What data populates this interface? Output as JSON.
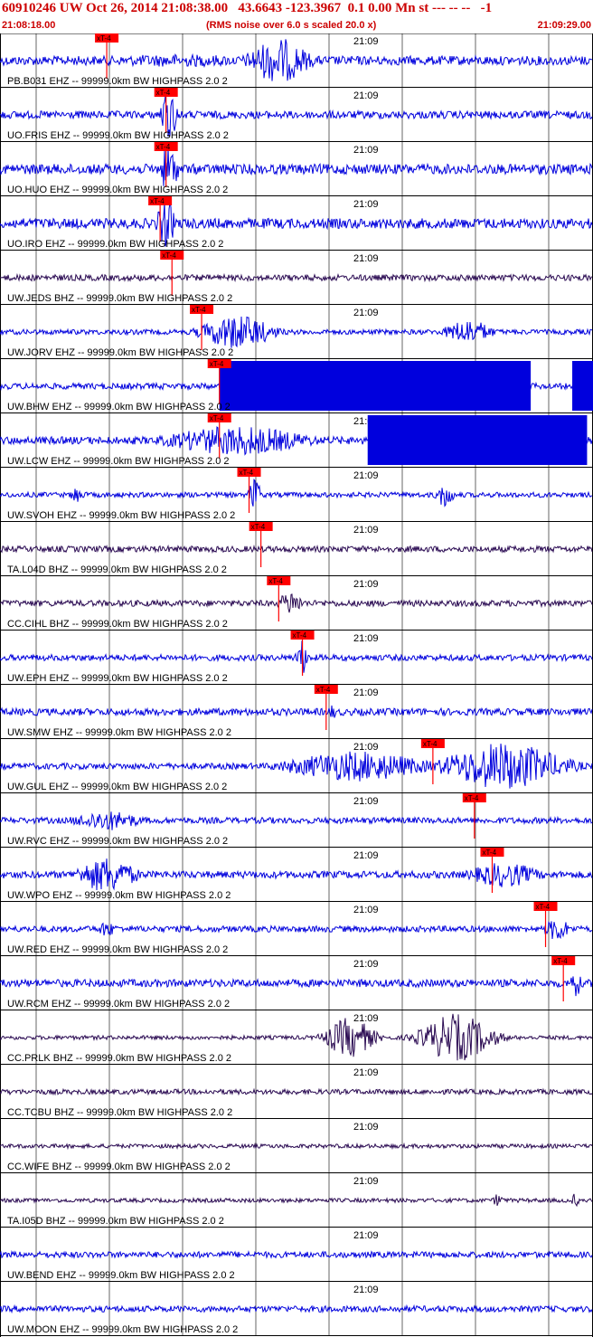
{
  "header": {
    "title": "60910246 UW Oct 26, 2014 21:08:38.00   43.6643 -123.3967  0.1 0.00 Mn st --- -- --   -1",
    "start_time": "21:08:18.00",
    "noise_note": "(RMS noise over 6.0 s scaled 20.0 x)",
    "end_time": "21:09:29.00"
  },
  "colors": {
    "header_text": "#cc0000",
    "trace_blue": "#0000dd",
    "trace_dark": "#2a0a52",
    "pick": "#ff0000",
    "grid": "#000000"
  },
  "chart_data": {
    "type": "line",
    "title": "60910246 UW Oct 26, 2014 21:08:38.00   43.6643 -123.3967  0.1 0.00 Mn st --- -- --   -1",
    "x_range": [
      "21:08:18.00",
      "21:09:29.00"
    ],
    "x_tick": "21:09",
    "pick_label": "xT-4",
    "grid": true,
    "traces": [
      {
        "label": "PB.B031 EHZ -- 99999.0km BW  HIGHPASS  2.0  2",
        "color": "blue",
        "pick": 0.18,
        "bursts": [
          [
            0.3,
            0.17,
            0.25
          ],
          [
            0.47,
            0.05,
            0.9
          ]
        ],
        "noise": 0.18
      },
      {
        "label": "UO.FRIS EHZ -- 99999.0km BW  HIGHPASS  2.0  2",
        "color": "blue",
        "pick": 0.28,
        "bursts": [
          [
            0.285,
            0.015,
            1.0
          ]
        ],
        "noise": 0.15
      },
      {
        "label": "UO.HUO EHZ -- 99999.0km BW  HIGHPASS  2.0  2",
        "color": "blue",
        "pick": 0.28,
        "bursts": [
          [
            0.285,
            0.015,
            1.0
          ]
        ],
        "noise": 0.2
      },
      {
        "label": "UO.IRO EHZ -- 99999.0km BW  HIGHPASS  2.0  2",
        "color": "blue",
        "pick": 0.27,
        "bursts": [
          [
            0.28,
            0.015,
            1.0
          ]
        ],
        "noise": 0.2
      },
      {
        "label": "UW.JEDS BHZ -- 99999.0km BW  HIGHPASS  2.0  2",
        "color": "dark",
        "pick": 0.29,
        "bursts": [],
        "noise": 0.12
      },
      {
        "label": "UW.JORV EHZ -- 99999.0km BW  HIGHPASS  2.0  2",
        "color": "blue",
        "pick": 0.34,
        "bursts": [
          [
            0.4,
            0.06,
            0.7
          ],
          [
            0.79,
            0.04,
            0.5
          ]
        ],
        "noise": 0.1
      },
      {
        "label": "UW.BHW EHZ -- 99999.0km BW  HIGHPASS  2.0  2",
        "color": "blue",
        "pick": 0.37,
        "bursts": [],
        "noise": 0.12,
        "saturated": [
          [
            0.37,
            0.895
          ],
          [
            0.965,
            1.0
          ]
        ]
      },
      {
        "label": "UW.LCW EHZ -- 99999.0km BW  HIGHPASS  2.0  2",
        "color": "blue",
        "pick": 0.37,
        "bursts": [
          [
            0.4,
            0.12,
            0.6
          ]
        ],
        "noise": 0.15,
        "saturated": [
          [
            0.62,
            0.99
          ]
        ]
      },
      {
        "label": "UW.SVOH EHZ -- 99999.0km BW  HIGHPASS  2.0  2",
        "color": "blue",
        "pick": 0.42,
        "bursts": [
          [
            0.13,
            0.01,
            0.4
          ],
          [
            0.43,
            0.01,
            0.7
          ],
          [
            0.75,
            0.015,
            0.5
          ]
        ],
        "noise": 0.1
      },
      {
        "label": "TA.L04D BHZ -- 99999.0km BW  HIGHPASS  2.0  2",
        "color": "dark",
        "pick": 0.44,
        "bursts": [],
        "noise": 0.12
      },
      {
        "label": "CC.CIHL BHZ -- 99999.0km BW  HIGHPASS  2.0  2",
        "color": "dark",
        "pick": 0.47,
        "bursts": [
          [
            0.49,
            0.02,
            0.5
          ]
        ],
        "noise": 0.12
      },
      {
        "label": "UW.EPH EHZ -- 99999.0km BW  HIGHPASS  2.0  2",
        "color": "blue",
        "pick": 0.51,
        "bursts": [
          [
            0.51,
            0.01,
            0.7
          ]
        ],
        "noise": 0.12
      },
      {
        "label": "UW.SMW EHZ -- 99999.0km BW  HIGHPASS  2.0  2",
        "color": "blue",
        "pick": 0.55,
        "bursts": [
          [
            0.56,
            0.008,
            0.3
          ]
        ],
        "noise": 0.14
      },
      {
        "label": "UW.GUL EHZ -- 99999.0km BW  HIGHPASS  2.0  2",
        "color": "blue",
        "pick": 0.73,
        "bursts": [
          [
            0.6,
            0.12,
            0.6
          ],
          [
            0.85,
            0.1,
            0.95
          ]
        ],
        "noise": 0.12
      },
      {
        "label": "UW.RVC EHZ -- 99999.0km BW  HIGHPASS  2.0  2",
        "color": "blue",
        "pick": 0.8,
        "bursts": [
          [
            0.18,
            0.06,
            0.4
          ]
        ],
        "noise": 0.12
      },
      {
        "label": "UW.WPO EHZ -- 99999.0km BW  HIGHPASS  2.0  2",
        "color": "blue",
        "pick": 0.83,
        "bursts": [
          [
            0.18,
            0.05,
            0.7
          ],
          [
            0.85,
            0.06,
            0.5
          ]
        ],
        "noise": 0.14
      },
      {
        "label": "UW.RED EHZ -- 99999.0km BW  HIGHPASS  2.0  2",
        "color": "blue",
        "pick": 0.92,
        "bursts": [
          [
            0.18,
            0.02,
            0.3
          ],
          [
            0.94,
            0.02,
            0.5
          ]
        ],
        "noise": 0.12
      },
      {
        "label": "UW.RCM EHZ -- 99999.0km BW  HIGHPASS  2.0  2",
        "color": "blue",
        "pick": 0.95,
        "bursts": [
          [
            0.97,
            0.01,
            0.6
          ]
        ],
        "noise": 0.15
      },
      {
        "label": "CC.PRLK BHZ -- 99999.0km BW  HIGHPASS  2.0  2",
        "color": "dark",
        "pick": null,
        "bursts": [
          [
            0.59,
            0.04,
            0.8
          ],
          [
            0.77,
            0.06,
            0.95
          ]
        ],
        "noise": 0.08
      },
      {
        "label": "CC.TCBU BHZ -- 99999.0km BW  HIGHPASS  2.0  2",
        "color": "dark",
        "pick": null,
        "bursts": [],
        "noise": 0.1
      },
      {
        "label": "CC.WIFE BHZ -- 99999.0km BW  HIGHPASS  2.0  2",
        "color": "dark",
        "pick": null,
        "bursts": [],
        "noise": 0.08
      },
      {
        "label": "TA.I05D BHZ -- 99999.0km BW  HIGHPASS  2.0  2",
        "color": "dark",
        "pick": null,
        "bursts": [
          [
            0.84,
            0.008,
            0.3
          ],
          [
            0.97,
            0.006,
            0.3
          ]
        ],
        "noise": 0.08
      },
      {
        "label": "UW.BEND EHZ -- 99999.0km BW  HIGHPASS  2.0  2",
        "color": "blue",
        "pick": null,
        "bursts": [],
        "noise": 0.12
      },
      {
        "label": "UW.MOON EHZ -- 99999.0km BW  HIGHPASS  2.0  2",
        "color": "blue",
        "pick": null,
        "bursts": [],
        "noise": 0.12
      }
    ]
  }
}
